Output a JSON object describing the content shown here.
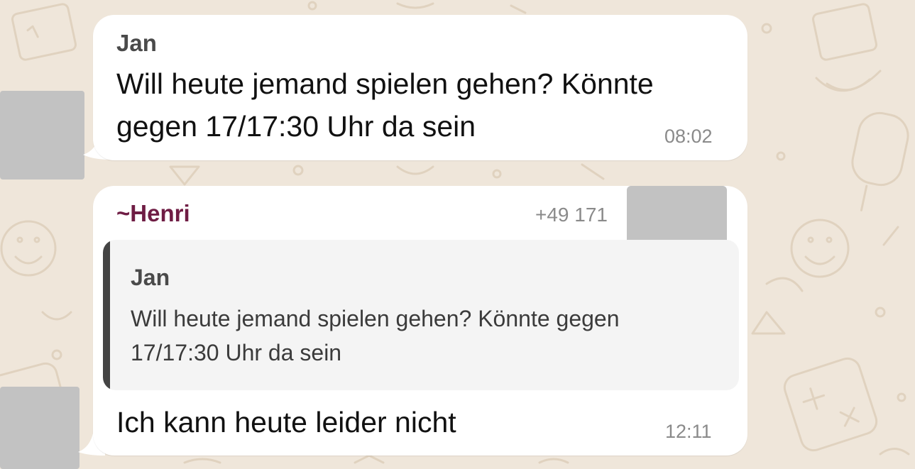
{
  "colors": {
    "wallpaper": "#efe6da",
    "bubble": "#ffffff",
    "sender_jan": "#4a4a4a",
    "sender_henri": "#6f1d44",
    "quote_bar": "#444444",
    "redaction": "#c2c2c2"
  },
  "messages": [
    {
      "sender": "Jan",
      "text_lines": [
        "Will heute jemand spielen gehen? Könnte",
        "gegen 17/17:30 Uhr da sein"
      ],
      "time": "08:02"
    },
    {
      "sender_prefix": "~",
      "sender": "Henri",
      "phone": "+49 171",
      "quote": {
        "sender": "Jan",
        "text_lines": [
          "Will heute jemand spielen gehen? Könnte gegen",
          "17/17:30 Uhr da sein"
        ]
      },
      "text": "Ich kann heute leider nicht",
      "time": "12:11"
    }
  ]
}
